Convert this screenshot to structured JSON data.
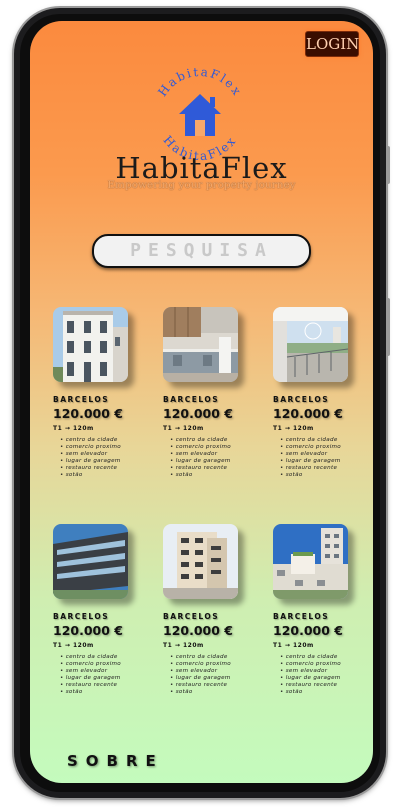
{
  "header": {
    "login_label": "LOGIN"
  },
  "brand": {
    "logo_ring_text_top": "HabitaFlex",
    "logo_ring_text_bottom": "HabitaFlex",
    "name": "HabitaFlex",
    "tagline": "Empowering your property journey"
  },
  "search": {
    "label": "PESQUISA"
  },
  "listings": [
    {
      "city": "BARCELOS",
      "price": "120.000 €",
      "typology": "T1 → 120m",
      "image": "white-townhouse-photo",
      "features": [
        "centro da cidade",
        "comercio proximo",
        "sem elevador",
        "lugar de garagem",
        "restauro recente",
        "sotão"
      ]
    },
    {
      "city": "BARCELOS",
      "price": "120.000 €",
      "typology": "T1 → 120m",
      "image": "kitchen-interior-photo",
      "features": [
        "centro da cidade",
        "comercio proximo",
        "sem elevador",
        "lugar de garagem",
        "restauro recente",
        "sotão"
      ]
    },
    {
      "city": "BARCELOS",
      "price": "120.000 €",
      "typology": "T1 → 120m",
      "image": "balcony-view-photo",
      "features": [
        "centro da cidade",
        "comercio proximo",
        "sem elevador",
        "lugar de garagem",
        "restauro recente",
        "sotão"
      ]
    },
    {
      "city": "BARCELOS",
      "price": "120.000 €",
      "typology": "T1 → 120m",
      "image": "modern-building-photo",
      "features": [
        "centro da cidade",
        "comercio proximo",
        "sem elevador",
        "lugar de garagem",
        "restauro recente",
        "sotão"
      ]
    },
    {
      "city": "BARCELOS",
      "price": "120.000 €",
      "typology": "T1 → 120m",
      "image": "apartment-block-photo",
      "features": [
        "centro da cidade",
        "comercio proximo",
        "sem elevador",
        "lugar de garagem",
        "restauro recente",
        "sotão"
      ]
    },
    {
      "city": "BARCELOS",
      "price": "120.000 €",
      "typology": "T1 → 120m",
      "image": "city-rooftop-photo",
      "features": [
        "centro da cidade",
        "comercio proximo",
        "sem elevador",
        "lugar de garagem",
        "restauro recente",
        "sotão"
      ]
    }
  ],
  "footer": {
    "about_label": "SOBRE"
  },
  "colors": {
    "brand_blue": "#2f5ad8",
    "gradient_top": "#fb8a3e",
    "gradient_bottom": "#c4fbbd"
  }
}
